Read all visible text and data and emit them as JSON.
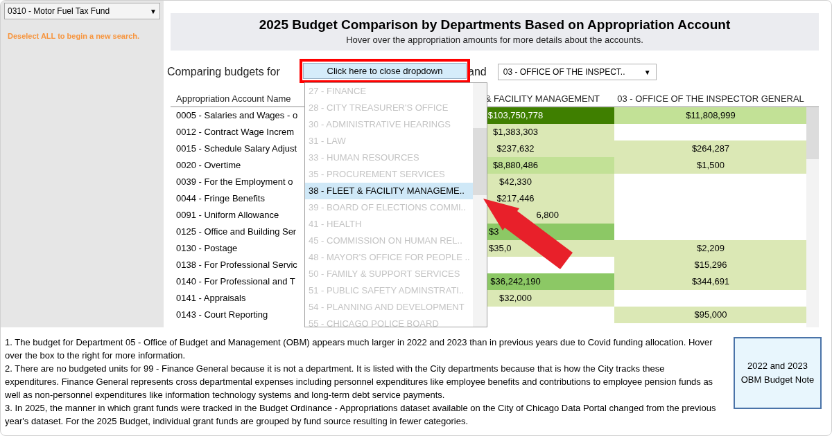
{
  "sidebar": {
    "fund_select": {
      "value": "0310 - Motor Fuel Tax Fund",
      "caret": "▼"
    },
    "hint": "Deselect ALL to begin a new search."
  },
  "header": {
    "title": "2025 Budget Comparison by Departments Based on Appropriation Account",
    "subtitle": "Hover over the appropriation amounts for more details about the accounts."
  },
  "compare": {
    "label": "Comparing budgets for",
    "dropdown_button": "Click here to close dropdown",
    "conjunction": "and",
    "second_select": {
      "value": "03 - OFFICE OF THE INSPECT..",
      "caret": "▼"
    }
  },
  "dropdown_list": [
    {
      "label": "27 - FINANCE",
      "selected": false
    },
    {
      "label": "28 - CITY TREASURER'S OFFICE",
      "selected": false
    },
    {
      "label": "30 - ADMINISTRATIVE HEARINGS",
      "selected": false
    },
    {
      "label": "31 - LAW",
      "selected": false
    },
    {
      "label": "33 - HUMAN RESOURCES",
      "selected": false
    },
    {
      "label": "35 - PROCUREMENT SERVICES",
      "selected": false
    },
    {
      "label": "38 - FLEET & FACILITY MANAGEME..",
      "selected": true
    },
    {
      "label": "39 - BOARD OF ELECTIONS COMMI..",
      "selected": false
    },
    {
      "label": "41 - HEALTH",
      "selected": false
    },
    {
      "label": "45 - COMMISSION ON HUMAN REL..",
      "selected": false
    },
    {
      "label": "48 - MAYOR'S OFFICE FOR PEOPLE ..",
      "selected": false
    },
    {
      "label": "50 - FAMILY & SUPPORT SERVICES",
      "selected": false
    },
    {
      "label": "51 - PUBLIC SAFETY ADMINSTRATI..",
      "selected": false
    },
    {
      "label": "54 - PLANNING AND DEVELOPMENT",
      "selected": false
    },
    {
      "label": "55 - CHICAGO POLICE BOARD",
      "selected": false
    }
  ],
  "table": {
    "columns": [
      "Appropriation Account Name",
      "& FACILITY MANAGEMENT",
      "03 - OFFICE OF THE INSPECTOR GENERAL"
    ],
    "rows": [
      {
        "account": "0005 - Salaries and Wages - o",
        "dept_1": {
          "text": "$103,750,778",
          "color": "#3f7f00"
        },
        "dept_2": {
          "text": "$11,808,999",
          "color": "#c2e196"
        }
      },
      {
        "account": "0012 - Contract Wage Increm",
        "dept_1": {
          "text": "$1,383,303",
          "color": "#dbe8b5"
        },
        "dept_2": null
      },
      {
        "account": "0015 - Schedule Salary Adjust",
        "dept_1": {
          "text": "$237,632",
          "color": "#dbe8b5"
        },
        "dept_2": {
          "text": "$264,287",
          "color": "#dbe8b5"
        }
      },
      {
        "account": "0020 - Overtime",
        "dept_1": {
          "text": "$8,880,486",
          "color": "#c2e196"
        },
        "dept_2": {
          "text": "$1,500",
          "color": "#dbe8b5"
        }
      },
      {
        "account": "0039 - For the Employment o",
        "dept_1": {
          "text": "$42,330",
          "color": "#dbe8b5"
        },
        "dept_2": null
      },
      {
        "account": "0044 - Fringe Benefits",
        "dept_1": {
          "text": "$217,446",
          "color": "#dbe8b5"
        },
        "dept_2": null
      },
      {
        "account": "0091 - Uniform Allowance",
        "dept_1": {
          "text": "6,800",
          "color": "#dbe8b5",
          "kind": "tail"
        },
        "dept_2": null
      },
      {
        "account": "0125 - Office and Building Ser",
        "dept_1": {
          "text": "$3",
          "color": "#8cc865",
          "kind": "head"
        },
        "dept_2": null
      },
      {
        "account": "0130 - Postage",
        "dept_1": {
          "text": "$35,0",
          "color": "#dbe8b5",
          "kind": "head"
        },
        "dept_2": {
          "text": "$2,209",
          "color": "#dbe8b5"
        }
      },
      {
        "account": "0138 - For Professional Servic",
        "dept_1": null,
        "dept_2": {
          "text": "$15,296",
          "color": "#dbe8b5"
        }
      },
      {
        "account": "0140 - For Professional and T",
        "dept_1": {
          "text": "$36,242,190",
          "color": "#8cc865"
        },
        "dept_2": {
          "text": "$344,691",
          "color": "#dbe8b5"
        }
      },
      {
        "account": "0141 - Appraisals",
        "dept_1": {
          "text": "$32,000",
          "color": "#dbe8b5"
        },
        "dept_2": null
      },
      {
        "account": "0143 - Court Reporting",
        "dept_1": null,
        "dept_2": {
          "text": "$95,000",
          "color": "#dbe8b5"
        }
      }
    ]
  },
  "notes": [
    "1. The budget for Department 05 - Office of Budget and Management (OBM) appears much larger in 2022 and 2023 than in previous years due to Covid funding allocation. Hover over the box to the right for more information.",
    "2. There are no budgeted units for 99 - Finance General because it is not a department. It is listed with the City departments because that is how the City tracks these expenditures. Finance General represents cross departmental expenses including personnel expenditures like employee benefits and contributions to employee pension funds as well as non-personnel expenditures like information technology systems and long-term debt service payments.",
    "3. In 2025, the manner in which grant funds were tracked in the Budget Ordinance - Appropriations dataset available on the City of Chicago Data Portal changed from the previous year's dataset. For the 2025 Budget, individual grant funds are grouped by fund source resulting in fewer categories."
  ],
  "note_box": "2022 and 2023 OBM Budget Note"
}
